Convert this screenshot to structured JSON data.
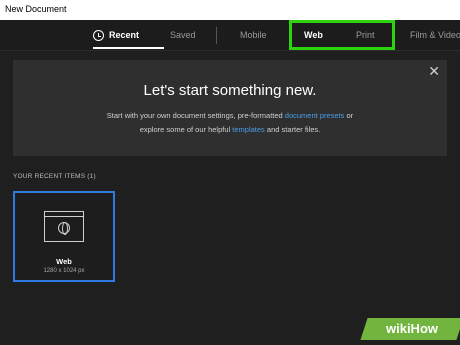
{
  "window": {
    "title": "New Document"
  },
  "tabs": {
    "recent": "Recent",
    "saved": "Saved",
    "mobile": "Mobile",
    "web": "Web",
    "print": "Print",
    "film": "Film & Video"
  },
  "banner": {
    "headline": "Let's start something new.",
    "line1_pre": "Start with your own document settings, pre-formatted ",
    "line1_link": "document presets",
    "line1_post": " or",
    "line2_pre": "explore some of our helpful ",
    "line2_link": "templates",
    "line2_post": " and starter files.",
    "close_icon": "close-icon",
    "link_color": "#4b9ee8"
  },
  "recent": {
    "label": "YOUR RECENT ITEMS",
    "count": "(1)",
    "items": [
      {
        "name": "Web",
        "size": "1280 x 1024 px",
        "icon": "web-document-icon"
      }
    ]
  },
  "colors": {
    "highlight": "#2ed30f",
    "selected_border": "#2d7be0"
  },
  "watermark": {
    "text": "wikiHow"
  }
}
